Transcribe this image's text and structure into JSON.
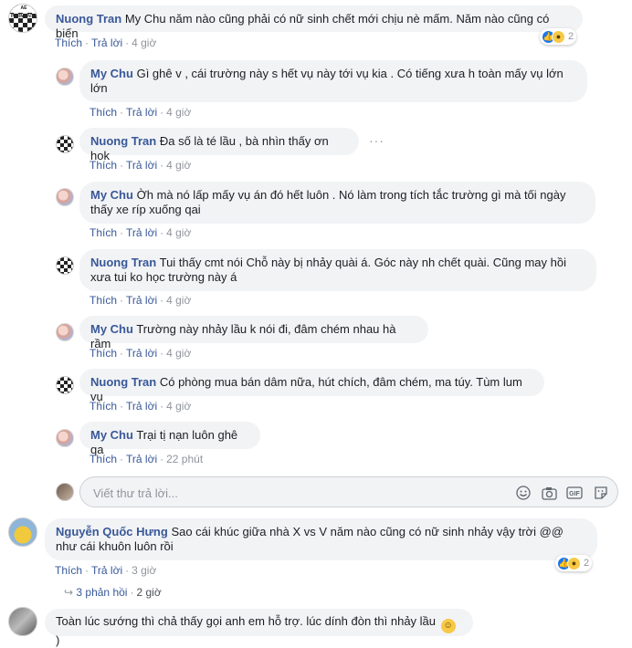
{
  "comments": [
    {
      "author": "Nuong Tran",
      "text": "My Chu năm nào cũng phải có nữ sinh chết mới chịu nè mấm. Năm nào cũng có biến",
      "like": "Thích",
      "reply": "Trả lời",
      "time": "4 giờ",
      "reactions_count": "2",
      "avatar_logo": "AE PERMANTA"
    },
    {
      "author": "My Chu",
      "text": "Gì ghê v , cái trường này s hết vụ này tới vụ kia . Có tiếng xưa h toàn mấy vụ lớn lớn",
      "like": "Thích",
      "reply": "Trả lời",
      "time": "4 giờ"
    },
    {
      "author": "Nuong Tran",
      "text": "Đa số là té lầu , bà nhìn thấy ơn hok",
      "like": "Thích",
      "reply": "Trả lời",
      "time": "4 giờ"
    },
    {
      "author": "My Chu",
      "text": "Ờh mà nó lấp mấy vụ án đó hết luôn . Nó làm trong tích tắc trường gì mà tối ngày thấy xe ríp xuống qai",
      "like": "Thích",
      "reply": "Trả lời",
      "time": "4 giờ"
    },
    {
      "author": "Nuong Tran",
      "text": "Tui thấy cmt nói Chỗ này bị nhảy quài á. Góc này nh chết quài. Cũng may hồi xưa tui ko học trường này á",
      "like": "Thích",
      "reply": "Trả lời",
      "time": "4 giờ"
    },
    {
      "author": "My Chu",
      "text": "Trường này nhảy lầu k nói đi, đâm chém nhau hà rầm",
      "like": "Thích",
      "reply": "Trả lời",
      "time": "4 giờ"
    },
    {
      "author": "Nuong Tran",
      "text": "Có phòng mua bán dâm nữa, hút chích, đâm chém, ma túy. Tùm lum vụ",
      "like": "Thích",
      "reply": "Trả lời",
      "time": "4 giờ"
    },
    {
      "author": "My Chu",
      "text": "Trại tị nạn luôn ghê qa",
      "like": "Thích",
      "reply": "Trả lời",
      "time": "22 phút"
    }
  ],
  "reply_box": {
    "placeholder": "Viết thư trả lời..."
  },
  "second_thread": {
    "author": "Nguyễn Quốc Hưng",
    "text": "Sao cái khúc giữa nhà X vs V năm nào cũng có nữ sinh nhảy vậy trời @@ như cái khuôn luôn rồi",
    "like": "Thích",
    "reply": "Trả lời",
    "time": "3 giờ",
    "reactions_count": "2",
    "replies_count": "3 phản hồi",
    "replies_time": "2 giờ"
  },
  "third_thread": {
    "text": "Toàn lúc sướng thì chả thấy gọi anh em hỗ trợ. lúc dính đòn thì nhảy lầu",
    "trailing": ")"
  },
  "icons": [
    "like-icon",
    "wow-icon",
    "haha-icon",
    "more-dots-icon",
    "emoji-icon",
    "camera-icon",
    "gif-icon",
    "sticker-icon",
    "reply-arrow-icon",
    "smile-emoji-icon"
  ],
  "colors": {
    "name": "#385898",
    "bubble": "#f2f3f5",
    "meta": "#90949c",
    "like": "#1877f2"
  }
}
